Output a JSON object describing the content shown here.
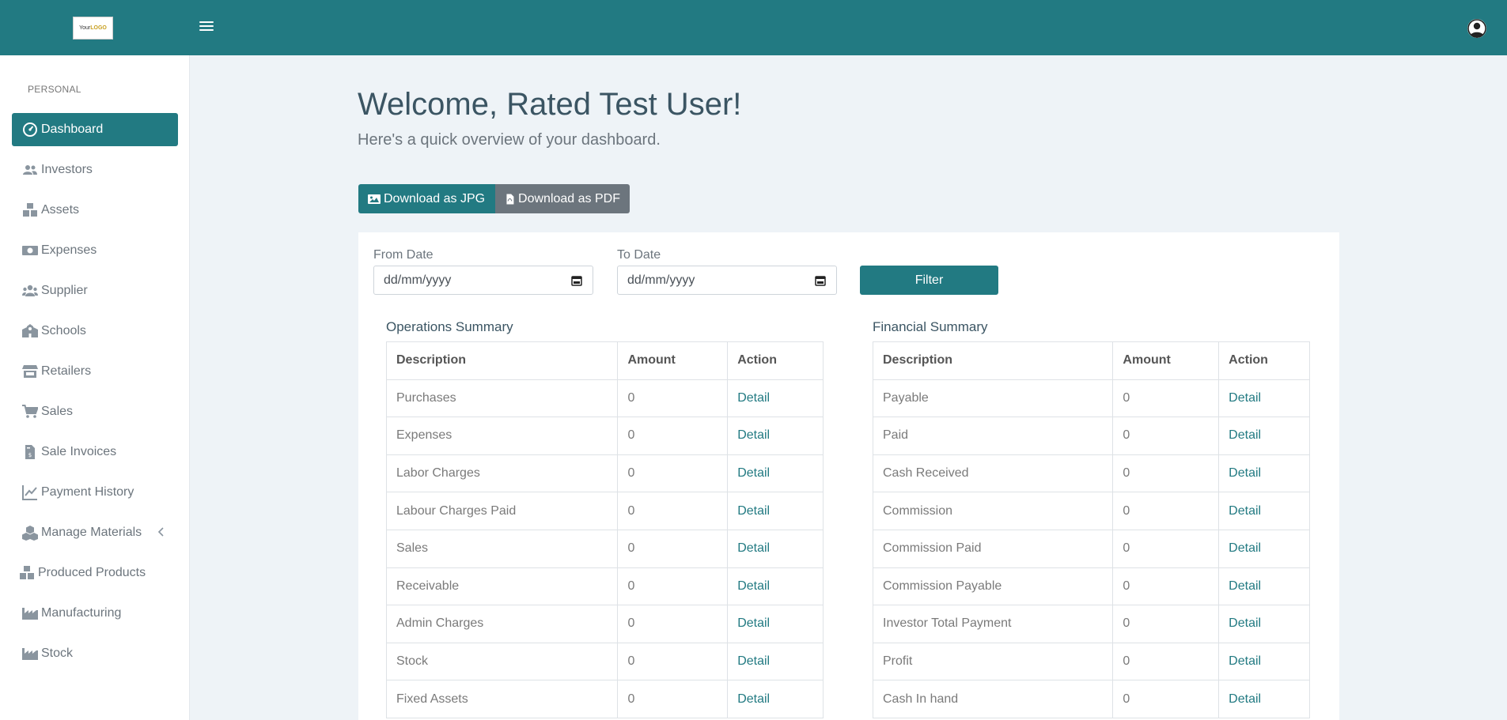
{
  "header": {
    "logo_text_prefix": "Your",
    "logo_text_brand": "LOGO",
    "menu_icon": "hamburger-icon",
    "avatar_icon": "user-avatar-icon"
  },
  "sidebar": {
    "heading": "PERSONAL",
    "items": [
      {
        "label": "Dashboard",
        "icon": "dashboard-icon",
        "active": true
      },
      {
        "label": "Investors",
        "icon": "users-icon"
      },
      {
        "label": "Assets",
        "icon": "boxes-icon"
      },
      {
        "label": "Expenses",
        "icon": "money-icon"
      },
      {
        "label": "Supplier",
        "icon": "user-group-icon"
      },
      {
        "label": "Schools",
        "icon": "school-icon"
      },
      {
        "label": "Retailers",
        "icon": "store-icon"
      },
      {
        "label": "Sales",
        "icon": "cart-icon"
      },
      {
        "label": "Sale Invoices",
        "icon": "invoice-icon"
      },
      {
        "label": "Payment History",
        "icon": "chart-line-icon"
      },
      {
        "label": "Manage Materials",
        "icon": "cubes-icon",
        "expandable": true
      },
      {
        "label": "Produced Products",
        "icon": "boxes-icon"
      },
      {
        "label": "Manufacturing",
        "icon": "industry-icon"
      },
      {
        "label": "Stock",
        "icon": "industry-icon"
      }
    ]
  },
  "main": {
    "welcome": "Welcome, Rated Test User!",
    "subtitle": "Here's a quick overview of your dashboard.",
    "download_jpg": "Download as JPG",
    "download_pdf": "Download as PDF",
    "filters": {
      "from_label": "From Date",
      "from_placeholder": "dd/mm/yyyy",
      "to_label": "To Date",
      "to_placeholder": "dd/mm/yyyy",
      "filter_button": "Filter"
    },
    "operations": {
      "title": "Operations Summary",
      "columns": [
        "Description",
        "Amount",
        "Action"
      ],
      "rows": [
        {
          "description": "Purchases",
          "amount": "0",
          "action": "Detail"
        },
        {
          "description": "Expenses",
          "amount": "0",
          "action": "Detail"
        },
        {
          "description": "Labor Charges",
          "amount": "0",
          "action": "Detail"
        },
        {
          "description": "Labour Charges Paid",
          "amount": "0",
          "action": "Detail"
        },
        {
          "description": "Sales",
          "amount": "0",
          "action": "Detail"
        },
        {
          "description": "Receivable",
          "amount": "0",
          "action": "Detail"
        },
        {
          "description": "Admin Charges",
          "amount": "0",
          "action": "Detail"
        },
        {
          "description": "Stock",
          "amount": "0",
          "action": "Detail"
        },
        {
          "description": "Fixed Assets",
          "amount": "0",
          "action": "Detail"
        }
      ]
    },
    "financial": {
      "title": "Financial Summary",
      "columns": [
        "Description",
        "Amount",
        "Action"
      ],
      "rows": [
        {
          "description": "Payable",
          "amount": "0",
          "action": "Detail"
        },
        {
          "description": "Paid",
          "amount": "0",
          "action": "Detail"
        },
        {
          "description": "Cash Received",
          "amount": "0",
          "action": "Detail"
        },
        {
          "description": "Commission",
          "amount": "0",
          "action": "Detail"
        },
        {
          "description": "Commission Paid",
          "amount": "0",
          "action": "Detail"
        },
        {
          "description": "Commission Payable",
          "amount": "0",
          "action": "Detail"
        },
        {
          "description": "Investor Total Payment",
          "amount": "0",
          "action": "Detail"
        },
        {
          "description": "Profit",
          "amount": "0",
          "action": "Detail"
        },
        {
          "description": "Cash In hand",
          "amount": "0",
          "action": "Detail"
        }
      ]
    }
  },
  "colors": {
    "primary": "#227a82",
    "secondary": "#6c757d",
    "background": "#eef3f7"
  }
}
